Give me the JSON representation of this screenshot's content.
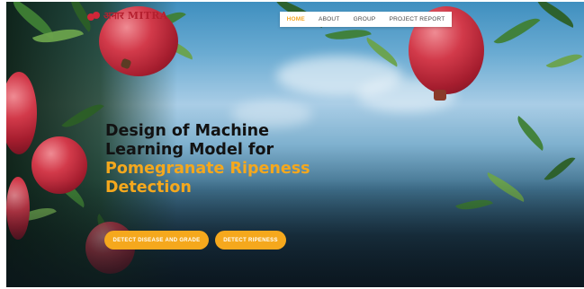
{
  "logo": {
    "text": "अनार MITRA",
    "icon": "pomegranate-icon",
    "color": "#b5202f"
  },
  "nav": {
    "items": [
      {
        "label": "HOME",
        "active": true
      },
      {
        "label": "ABOUT",
        "active": false
      },
      {
        "label": "GROUP",
        "active": false
      },
      {
        "label": "PROJECT REPORT",
        "active": false
      }
    ],
    "accent": "#f5a623"
  },
  "hero": {
    "title_line1": "Design of Machine",
    "title_line2": "Learning Model for",
    "title_line3": "Pomegranate Ripeness",
    "title_line4": "Detection",
    "dark_color": "#121212",
    "accent_color": "#f5a81d"
  },
  "actions": {
    "disease_button": "DETECT DISEASE AND GRADE",
    "ripeness_button": "DETECT RIPENESS"
  }
}
